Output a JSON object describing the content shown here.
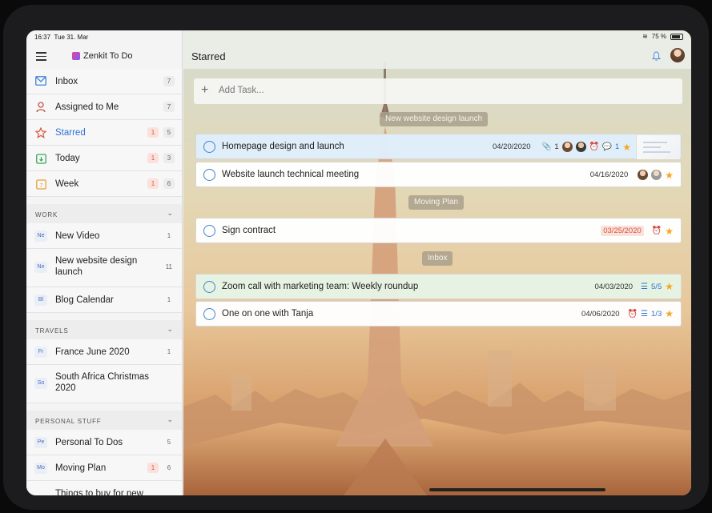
{
  "status": {
    "time": "16:37",
    "date": "Tue 31. Mar",
    "battery": "75 %"
  },
  "app": {
    "name": "Zenkit To Do"
  },
  "sidebar": {
    "main_items": [
      {
        "label": "Inbox",
        "icon": "inbox-icon",
        "count": "7",
        "overdue": ""
      },
      {
        "label": "Assigned to Me",
        "icon": "person-icon",
        "count": "7",
        "overdue": ""
      },
      {
        "label": "Starred",
        "icon": "star-icon",
        "count": "5",
        "overdue": "1",
        "active": true
      },
      {
        "label": "Today",
        "icon": "calendar-today-icon",
        "count": "3",
        "overdue": "1"
      },
      {
        "label": "Week",
        "icon": "calendar-week-icon",
        "count": "6",
        "overdue": "1"
      }
    ],
    "sections": [
      {
        "title": "WORK",
        "lists": [
          {
            "abbr": "Ne",
            "label": "New Video",
            "count": "1"
          },
          {
            "abbr": "Ne",
            "label": "New website design launch",
            "count": "11"
          },
          {
            "abbr": "Bl",
            "label": "Blog Calendar",
            "count": "1"
          }
        ]
      },
      {
        "title": "TRAVELS",
        "lists": [
          {
            "abbr": "Fr",
            "label": "France June 2020",
            "count": "1"
          },
          {
            "abbr": "So",
            "label": "South Africa Christmas 2020",
            "count": ""
          }
        ]
      },
      {
        "title": "PERSONAL STUFF",
        "lists": [
          {
            "abbr": "Pe",
            "label": "Personal To Dos",
            "count": "5"
          },
          {
            "abbr": "Mo",
            "label": "Moving Plan",
            "count": "6",
            "overdue": "1"
          },
          {
            "abbr": "",
            "label": "Things to buy for new",
            "count": ""
          }
        ]
      }
    ]
  },
  "main": {
    "title": "Starred",
    "add_task_placeholder": "Add Task...",
    "groups": [
      "New website design launch",
      "Moving Plan",
      "Inbox"
    ],
    "tasks": [
      {
        "label": "Homepage design and launch",
        "date": "04/20/2020",
        "attachments": "1",
        "comments": "1"
      },
      {
        "label": "Website launch technical meeting",
        "date": "04/16/2020"
      },
      {
        "label": "Sign contract",
        "date": "03/25/2020"
      },
      {
        "label": "Zoom call with marketing team: Weekly roundup",
        "date": "04/03/2020",
        "checklist": "5/5"
      },
      {
        "label": "One on one with Tanja",
        "date": "04/06/2020",
        "checklist": "1/3"
      }
    ]
  },
  "colors": {
    "accent": "#3d82d6",
    "starred": "#f5a623",
    "overdue": "#d9573d",
    "alarm": "#3aa55b"
  }
}
